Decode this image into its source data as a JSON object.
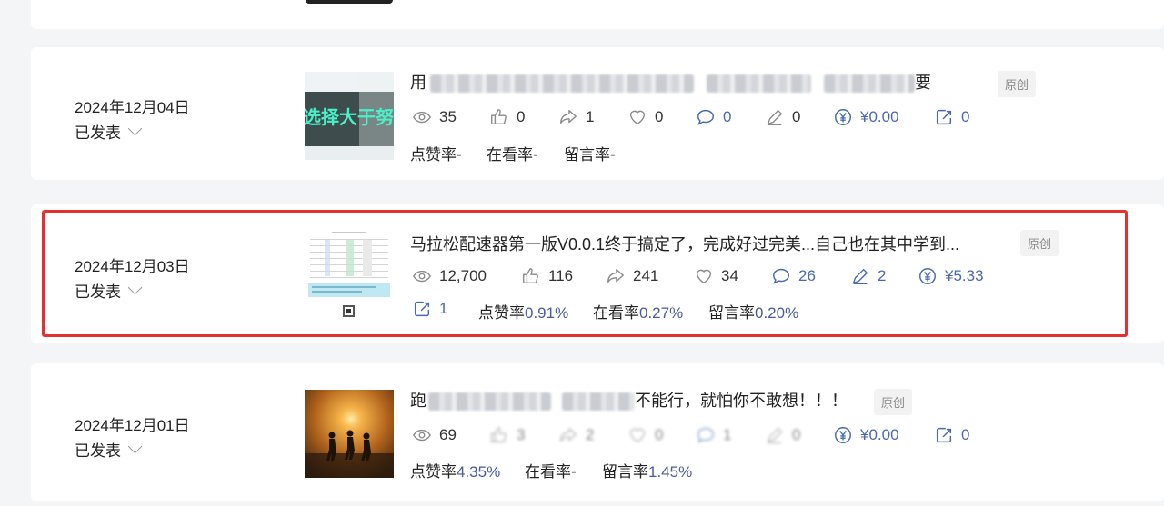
{
  "badge_label": "原创",
  "articles": [
    {
      "date": "2024年12月04日",
      "status": "已发表",
      "title_start": "用",
      "title_end": "要",
      "thumb_text": "选择大于努",
      "stats": {
        "views": "35",
        "likes": "0",
        "shares": "1",
        "favorites": "0",
        "comments": "0",
        "edits": "0",
        "reward": "¥0.00",
        "forwards": "0"
      },
      "rates": {
        "like_label": "点赞率",
        "like_value": "-",
        "watch_label": "在看率",
        "watch_value": "-",
        "comment_label": "留言率",
        "comment_value": "-"
      }
    },
    {
      "date": "2024年12月03日",
      "status": "已发表",
      "title": "马拉松配速器第一版V0.0.1终于搞定了，完成好过完美...自己也在其中学到...",
      "stats": {
        "views": "12,700",
        "likes": "116",
        "shares": "241",
        "favorites": "34",
        "comments": "26",
        "edits": "2",
        "reward": "¥5.33",
        "forwards": "1"
      },
      "rates": {
        "like_label": "点赞率",
        "like_value": "0.91%",
        "watch_label": "在看率",
        "watch_value": "0.27%",
        "comment_label": "留言率",
        "comment_value": "0.20%"
      }
    },
    {
      "date": "2024年12月01日",
      "status": "已发表",
      "title_start": "跑",
      "title_end": "不能行，就怕你不敢想！！！",
      "stats": {
        "views": "69",
        "likes": "3",
        "shares": "2",
        "favorites": "0",
        "comments": "1",
        "edits": "0",
        "reward": "¥0.00",
        "forwards": "0"
      },
      "rates": {
        "like_label": "点赞率",
        "like_value": "4.35%",
        "watch_label": "在看率",
        "watch_value": "-",
        "comment_label": "留言率",
        "comment_value": "1.45%"
      }
    }
  ],
  "icons": [
    "eye-icon",
    "thumbs-up-icon",
    "share-arrow-icon",
    "heart-icon",
    "comment-icon",
    "pen-icon",
    "yuan-icon",
    "forward-icon",
    "chevron-down-icon"
  ]
}
